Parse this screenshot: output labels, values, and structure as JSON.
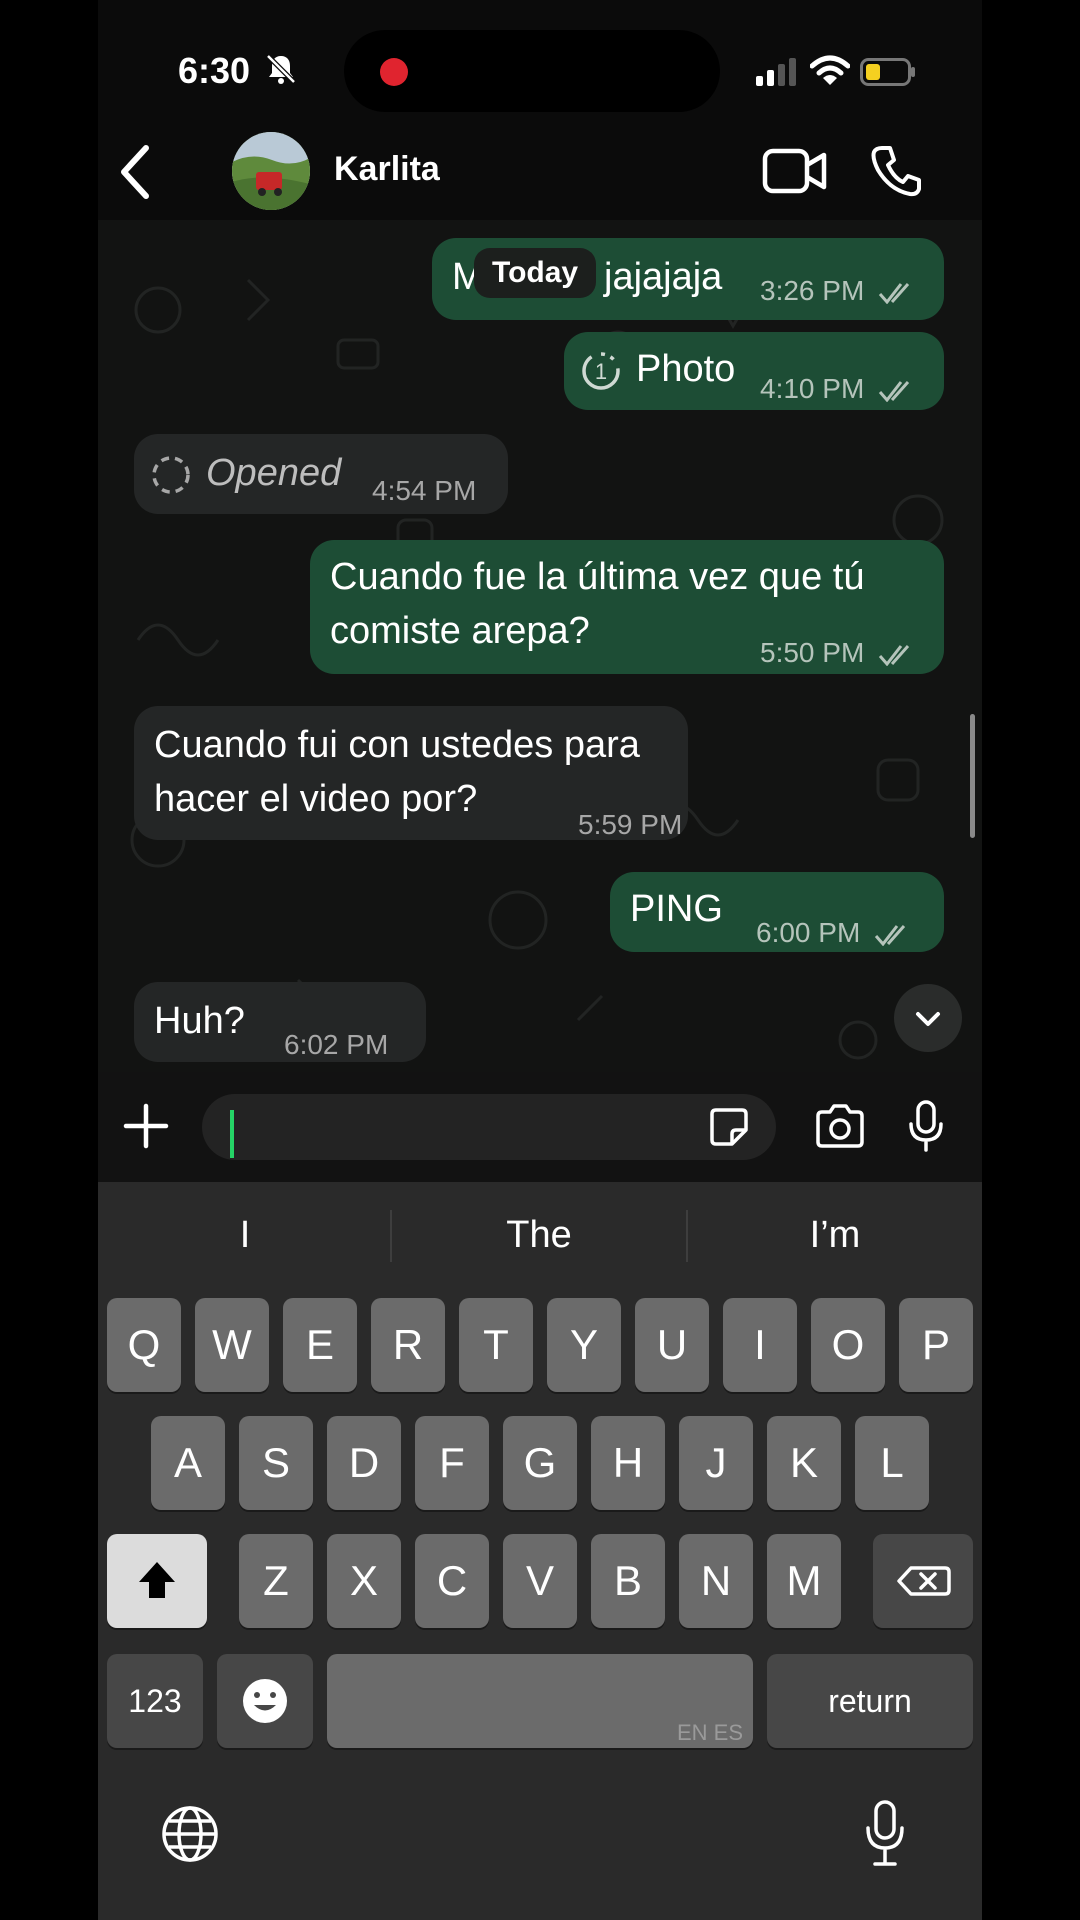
{
  "status_bar": {
    "time": "6:30"
  },
  "header": {
    "contact_name": "Karlita"
  },
  "chat": {
    "date_chip": "Today",
    "messages": [
      {
        "dir": "out",
        "text": "M",
        "text2": "jajajaja",
        "time": "3:26 PM",
        "ticks": true
      },
      {
        "dir": "out",
        "text": "Photo",
        "icon": "view-once-icon",
        "time": "4:10 PM",
        "ticks": true
      },
      {
        "dir": "in",
        "text": "Opened",
        "icon": "view-once-opened-icon",
        "time": "4:54 PM"
      },
      {
        "dir": "out",
        "line1": "Cuando fue la última vez que tú",
        "line2": "comiste arepa?",
        "time": "5:50 PM",
        "ticks": true
      },
      {
        "dir": "in",
        "line1": "Cuando fui con ustedes para",
        "line2": "hacer el video por?",
        "time": "5:59 PM"
      },
      {
        "dir": "out",
        "text": "PING",
        "time": "6:00 PM",
        "ticks": true
      },
      {
        "dir": "in",
        "text": "Huh?",
        "time": "6:02 PM"
      }
    ]
  },
  "keyboard": {
    "suggestions": [
      "I",
      "The",
      "I’m"
    ],
    "row1": [
      "Q",
      "W",
      "E",
      "R",
      "T",
      "Y",
      "U",
      "I",
      "O",
      "P"
    ],
    "row2": [
      "A",
      "S",
      "D",
      "F",
      "G",
      "H",
      "J",
      "K",
      "L"
    ],
    "row3": [
      "Z",
      "X",
      "C",
      "V",
      "B",
      "N",
      "M"
    ],
    "numbers_label": "123",
    "space_lang": "EN ES",
    "return_label": "return"
  },
  "colors": {
    "outgoing": "#1d4d35",
    "incoming": "#242626",
    "accent": "#25d366"
  }
}
